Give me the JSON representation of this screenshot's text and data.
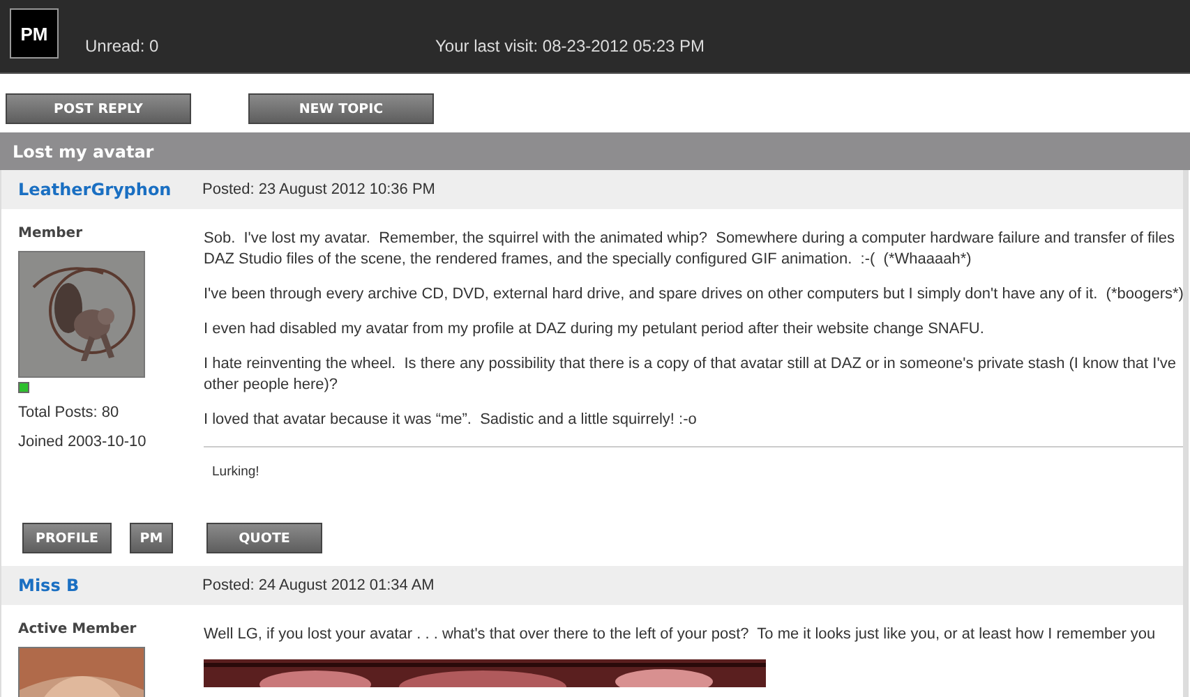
{
  "header": {
    "logo": "PM",
    "unread": "Unread: 0",
    "last_visit": "Your last visit: 08-23-2012 05:23 PM"
  },
  "actions": [
    "POST REPLY",
    "NEW TOPIC"
  ],
  "topic_title": "Lost my avatar",
  "posts": [
    {
      "author": "LeatherGryphon",
      "posted": "Posted: 23 August 2012 10:36 PM",
      "rank": "Member",
      "online": true,
      "total_posts": "Total Posts:  80",
      "joined": "Joined  2003-10-10",
      "paragraphs": [
        [
          "Sob.  I've lost my avatar.  Remember, the squirrel with the animated whip?  Somewhere during a computer hardware failure and transfer of files",
          "DAZ Studio files of the scene, the rendered frames, and the specially configured GIF animation.  :-(  (*Whaaaah*)"
        ],
        [
          "I've been through every archive CD, DVD, external hard drive, and spare drives on other computers but I simply don't have any of it.  (*boogers*)"
        ],
        [
          "I even had disabled my avatar from my profile at DAZ during my petulant period after their website change SNAFU."
        ],
        [
          "I hate reinventing the wheel.  Is there any possibility that there is a copy of that avatar still at DAZ or in someone's private stash (I know that I've",
          "other people here)?"
        ],
        [
          "I loved that avatar because it was “me”.  Sadistic and a little squirrely! :-o"
        ]
      ],
      "signature": "Lurking!",
      "buttons": [
        "PROFILE",
        "PM",
        "QUOTE"
      ]
    },
    {
      "author": "Miss B",
      "posted": "Posted: 24 August 2012 01:34 AM",
      "rank": "Active Member",
      "paragraphs": [
        [
          "Well LG, if you lost your avatar . . . what's that over there to the left of your post?  To me it looks just like you, or at least how I remember you"
        ]
      ]
    }
  ]
}
